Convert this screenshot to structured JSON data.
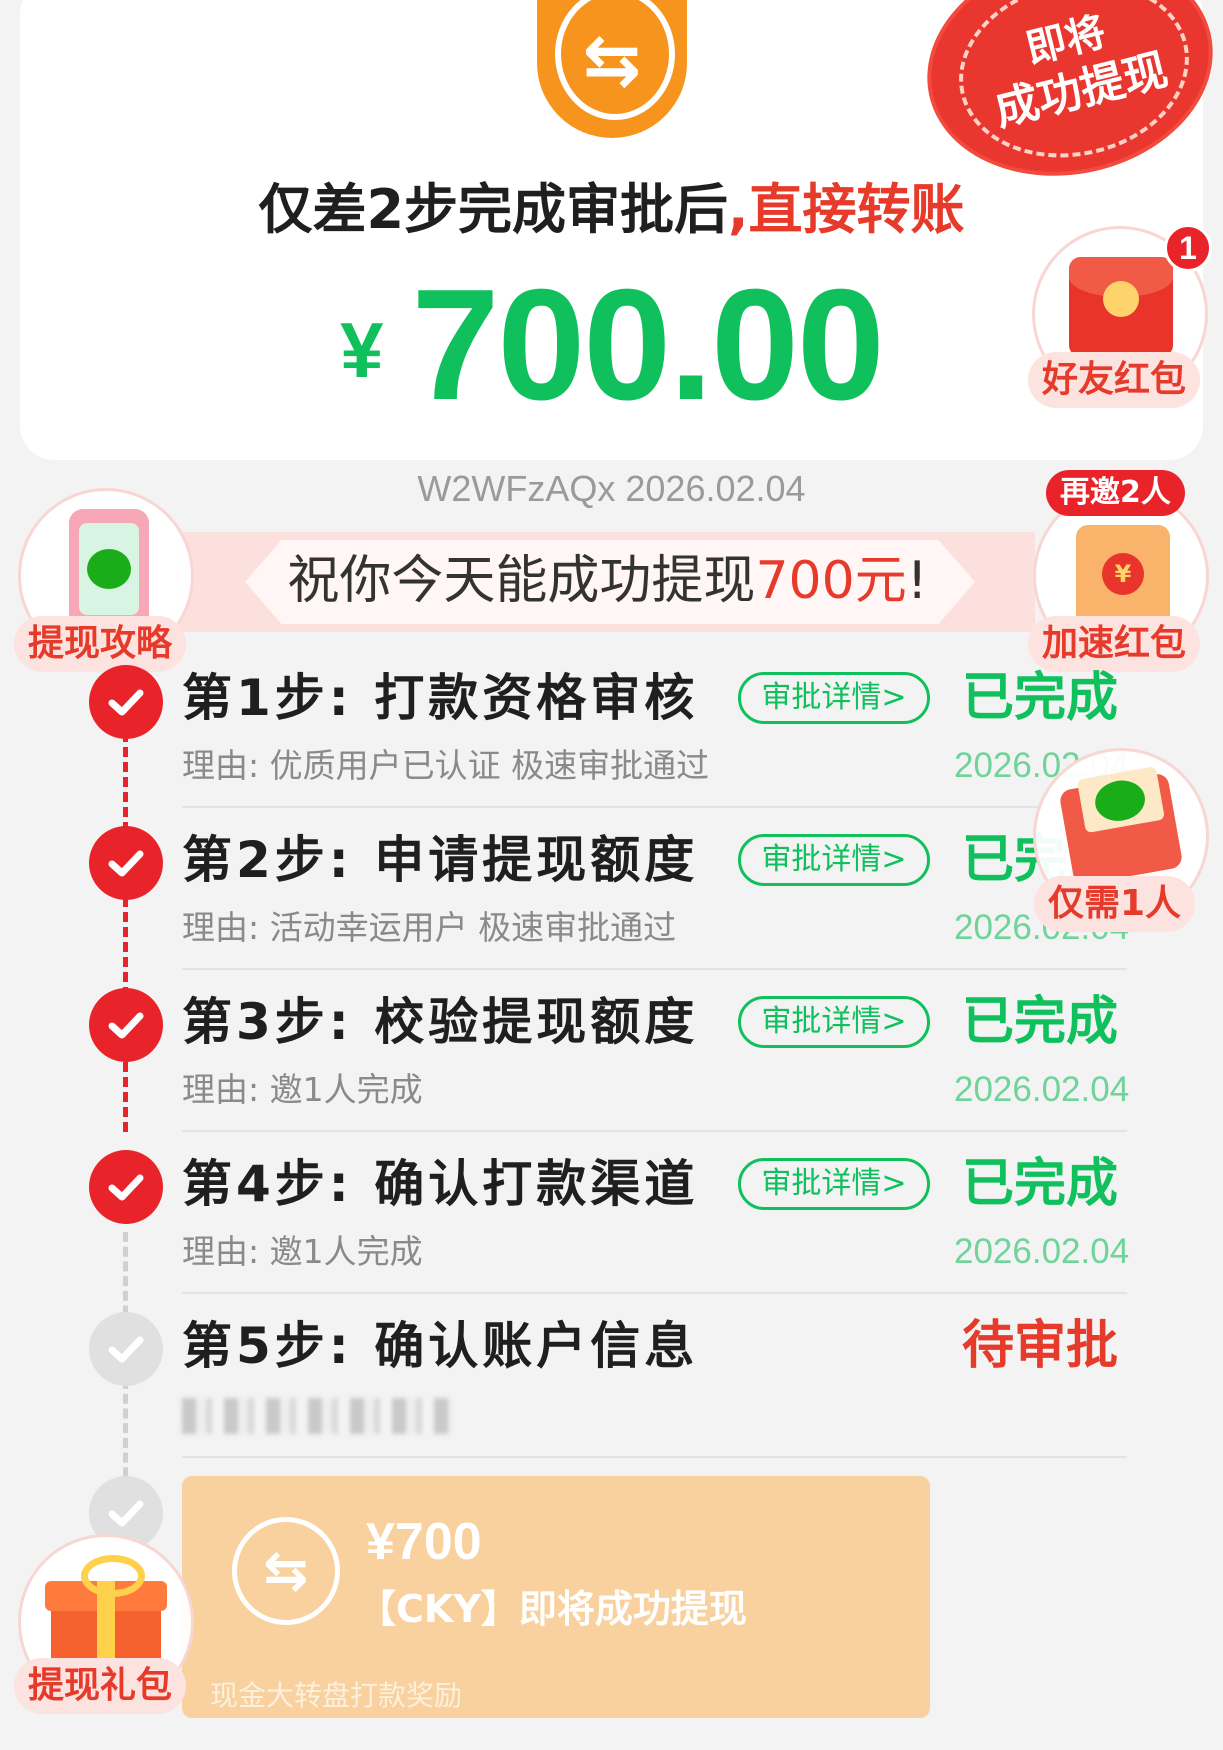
{
  "header": {
    "icon": "transfer-icon",
    "headline_prefix": "仅差2步完成审批后",
    "headline_sep": ",",
    "headline_highlight": "直接转账",
    "currency": "¥",
    "amount": "700.00"
  },
  "stamp": {
    "line1": "即将",
    "line2": "成功提现"
  },
  "widgets": {
    "friend_red_packet": {
      "label": "好友红包",
      "badge": "1"
    },
    "speed_red_packet": {
      "label": "加速红包",
      "pill": "再邀2人"
    },
    "withdraw_guide": {
      "label": "提现攻略"
    },
    "only_one_person": {
      "label": "仅需1人"
    },
    "withdraw_gift": {
      "label": "提现礼包"
    }
  },
  "code_line": "W2WFzAQx 2026.02.04",
  "banner": {
    "prefix": "祝你今天能成功提现",
    "highlight": "700元",
    "suffix": "!"
  },
  "steps": [
    {
      "title": "第1步: 打款资格审核",
      "button": "审批详情>",
      "status": "已完成",
      "reason": "理由: 优质用户已认证 极速审批通过",
      "date": "2026.02.04"
    },
    {
      "title": "第2步: 申请提现额度",
      "button": "审批详情>",
      "status": "已完成",
      "reason": "理由: 活动幸运用户 极速审批通过",
      "date": "2026.02.04"
    },
    {
      "title": "第3步: 校验提现额度",
      "button": "审批详情>",
      "status": "已完成",
      "reason": "理由: 邀1人完成",
      "date": "2026.02.04"
    },
    {
      "title": "第4步: 确认打款渠道",
      "button": "审批详情>",
      "status": "已完成",
      "reason": "理由: 邀1人完成",
      "date": "2026.02.04"
    },
    {
      "title": "第5步: 确认账户信息",
      "status": "待审批"
    }
  ],
  "payout": {
    "icon": "transfer-icon",
    "amount": "¥700",
    "description": "【CKY】即将成功提现",
    "footer": "现金大转盘打款奖励"
  },
  "colors": {
    "green": "#0fc05c",
    "red": "#e63a2b",
    "orange": "#f7941d",
    "card": "#f8d19e"
  }
}
